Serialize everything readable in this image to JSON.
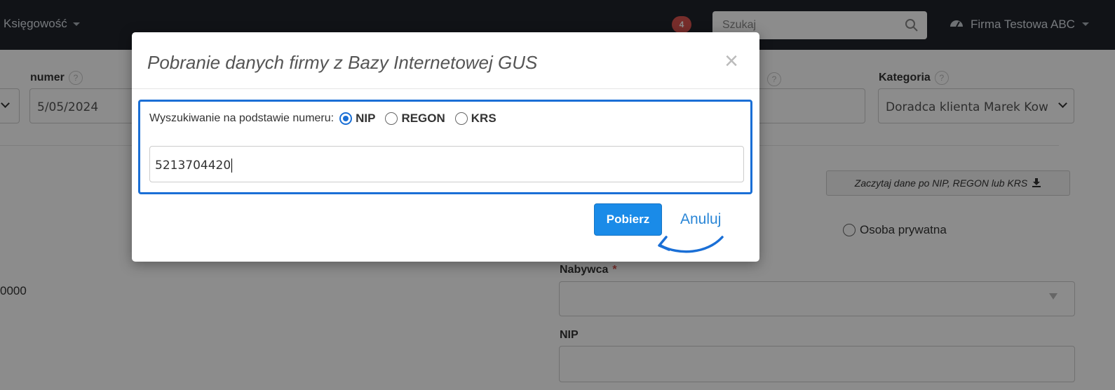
{
  "navbar": {
    "menu_label": "Księgowość",
    "notifications_count": "4",
    "search_placeholder": "Szukaj",
    "company_name": "Firma Testowa ABC"
  },
  "form": {
    "number_label": "numer",
    "number_value": "5/05/2024",
    "category_label": "Kategoria",
    "category_value": "Doradca klienta Marek Kow",
    "fetch_data_button": "Zaczytaj dane po NIP, REGON lub KRS",
    "private_person_label": "Osoba prywatna",
    "buyer_label": "Nabywca",
    "required_mark": "*",
    "nip_label": "NIP",
    "partial_value": "0000"
  },
  "modal": {
    "title": "Pobranie danych firmy z Bazy Internetowej GUS",
    "close_symbol": "×",
    "search_by_label": "Wyszukiwanie na podstawie numeru:",
    "options": [
      {
        "label": "NIP",
        "selected": true
      },
      {
        "label": "REGON",
        "selected": false
      },
      {
        "label": "KRS",
        "selected": false
      }
    ],
    "number_value": "5213704420",
    "submit_label": "Pobierz",
    "cancel_label": "Anuluj"
  },
  "colors": {
    "accent": "#1a6fd6",
    "primary_button": "#1a8be8",
    "navbar": "#1f242b",
    "badge": "#d9534f"
  },
  "icons": [
    "chevron-down-icon",
    "search-icon",
    "dashboard-icon",
    "help-icon",
    "download-icon",
    "close-icon",
    "annotation-arrow-icon"
  ]
}
